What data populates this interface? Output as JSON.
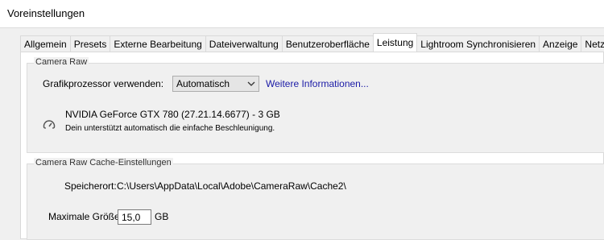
{
  "window": {
    "title": "Voreinstellungen"
  },
  "tabs": [
    {
      "label": "Allgemein"
    },
    {
      "label": "Presets"
    },
    {
      "label": "Externe Bearbeitung"
    },
    {
      "label": "Dateiverwaltung"
    },
    {
      "label": "Benutzeroberfläche"
    },
    {
      "label": "Leistung",
      "active": true
    },
    {
      "label": "Lightroom Synchronisieren"
    },
    {
      "label": "Anzeige"
    },
    {
      "label": "Netzwerk"
    }
  ],
  "camera_raw": {
    "group_title": "Camera Raw",
    "gpu_label": "Grafikprozessor verwenden:",
    "gpu_select_value": "Automatisch",
    "more_info_link": "Weitere Informationen...",
    "gpu_icon": "gauge-icon",
    "gpu_name": "NVIDIA GeForce GTX 780 (27.21.14.6677) - 3 GB",
    "gpu_status": "Dein unterstützt automatisch die einfache Beschleunigung."
  },
  "cache": {
    "group_title": "Camera Raw Cache-Einstellungen",
    "location_label": "Speicherort:",
    "location_path": "C:\\Users\\AppData\\Local\\Adobe\\CameraRaw\\Cache2\\",
    "max_size_label": "Maximale Größe:",
    "max_size_value": "15,0",
    "max_size_unit": "GB"
  }
}
